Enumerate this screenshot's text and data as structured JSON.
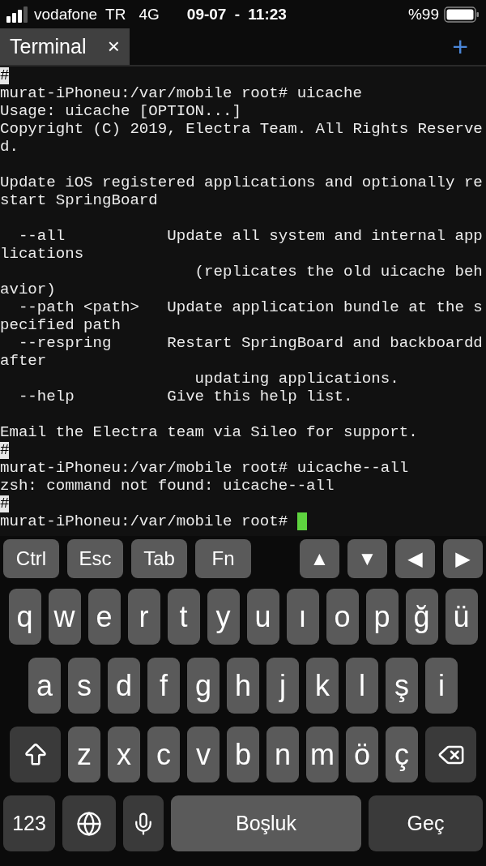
{
  "status_bar": {
    "carrier": "vodafone TR",
    "network": "4G",
    "time": "09-07 - 11:23",
    "battery": "%99"
  },
  "tabs": [
    {
      "label": "Terminal",
      "selected": true,
      "close": "×"
    }
  ],
  "new_tab": "+",
  "terminal": {
    "lines": [
      {
        "kind": "marker",
        "text": "#"
      },
      {
        "kind": "text",
        "text": "murat-iPhoneu:/var/mobile root# uicache"
      },
      {
        "kind": "text",
        "text": "Usage: uicache [OPTION...]"
      },
      {
        "kind": "text",
        "text": "Copyright (C) 2019, Electra Team. All Rights Reserve"
      },
      {
        "kind": "text",
        "text": "d."
      },
      {
        "kind": "blank"
      },
      {
        "kind": "text",
        "text": "Update iOS registered applications and optionally re"
      },
      {
        "kind": "text",
        "text": "start SpringBoard"
      },
      {
        "kind": "blank"
      },
      {
        "kind": "text",
        "text": "  --all           Update all system and internal app"
      },
      {
        "kind": "text",
        "text": "lications"
      },
      {
        "kind": "text",
        "text": "                     (replicates the old uicache beh"
      },
      {
        "kind": "text",
        "text": "avior)"
      },
      {
        "kind": "text",
        "text": "  --path <path>   Update application bundle at the s"
      },
      {
        "kind": "text",
        "text": "pecified path"
      },
      {
        "kind": "text",
        "text": "  --respring      Restart SpringBoard and backboardd"
      },
      {
        "kind": "text",
        "text": "after"
      },
      {
        "kind": "text",
        "text": "                     updating applications."
      },
      {
        "kind": "text",
        "text": "  --help          Give this help list."
      },
      {
        "kind": "blank"
      },
      {
        "kind": "text",
        "text": "Email the Electra team via Sileo for support."
      },
      {
        "kind": "marker",
        "text": "#"
      },
      {
        "kind": "text",
        "text": "murat-iPhoneu:/var/mobile root# uicache--all"
      },
      {
        "kind": "text",
        "text": "zsh: command not found: uicache--all"
      },
      {
        "kind": "marker",
        "text": "#"
      },
      {
        "kind": "prompt",
        "text": "murat-iPhoneu:/var/mobile root# "
      }
    ]
  },
  "accessory_keys": [
    {
      "label": "Ctrl",
      "kind": "text"
    },
    {
      "label": "Esc",
      "kind": "text"
    },
    {
      "label": "Tab",
      "kind": "text"
    },
    {
      "label": "Fn",
      "kind": "text"
    },
    {
      "label": "▲",
      "kind": "arrow"
    },
    {
      "label": "▼",
      "kind": "arrow"
    },
    {
      "label": "◀",
      "kind": "arrow"
    },
    {
      "label": "▶",
      "kind": "arrow"
    }
  ],
  "keyboard_rows": [
    [
      {
        "kind": "letter",
        "label": "q"
      },
      {
        "kind": "letter",
        "label": "w"
      },
      {
        "kind": "letter",
        "label": "e"
      },
      {
        "kind": "letter",
        "label": "r"
      },
      {
        "kind": "letter",
        "label": "t"
      },
      {
        "kind": "letter",
        "label": "y"
      },
      {
        "kind": "letter",
        "label": "u"
      },
      {
        "kind": "letter",
        "label": "ı"
      },
      {
        "kind": "letter",
        "label": "o"
      },
      {
        "kind": "letter",
        "label": "p"
      },
      {
        "kind": "letter",
        "label": "ğ"
      },
      {
        "kind": "letter",
        "label": "ü"
      }
    ],
    [
      {
        "kind": "letter",
        "label": "a"
      },
      {
        "kind": "letter",
        "label": "s"
      },
      {
        "kind": "letter",
        "label": "d"
      },
      {
        "kind": "letter",
        "label": "f"
      },
      {
        "kind": "letter",
        "label": "g"
      },
      {
        "kind": "letter",
        "label": "h"
      },
      {
        "kind": "letter",
        "label": "j"
      },
      {
        "kind": "letter",
        "label": "k"
      },
      {
        "kind": "letter",
        "label": "l"
      },
      {
        "kind": "letter",
        "label": "ş"
      },
      {
        "kind": "letter",
        "label": "i"
      }
    ],
    [
      {
        "kind": "shift"
      },
      {
        "kind": "letter",
        "label": "z"
      },
      {
        "kind": "letter",
        "label": "x"
      },
      {
        "kind": "letter",
        "label": "c"
      },
      {
        "kind": "letter",
        "label": "v"
      },
      {
        "kind": "letter",
        "label": "b"
      },
      {
        "kind": "letter",
        "label": "n"
      },
      {
        "kind": "letter",
        "label": "m"
      },
      {
        "kind": "letter",
        "label": "ö"
      },
      {
        "kind": "letter",
        "label": "ç"
      },
      {
        "kind": "backspace"
      }
    ],
    [
      {
        "kind": "function",
        "label": "123"
      },
      {
        "kind": "globe"
      },
      {
        "kind": "mic"
      },
      {
        "kind": "space",
        "label": "Boşluk"
      },
      {
        "kind": "return",
        "label": "Geç"
      }
    ]
  ]
}
